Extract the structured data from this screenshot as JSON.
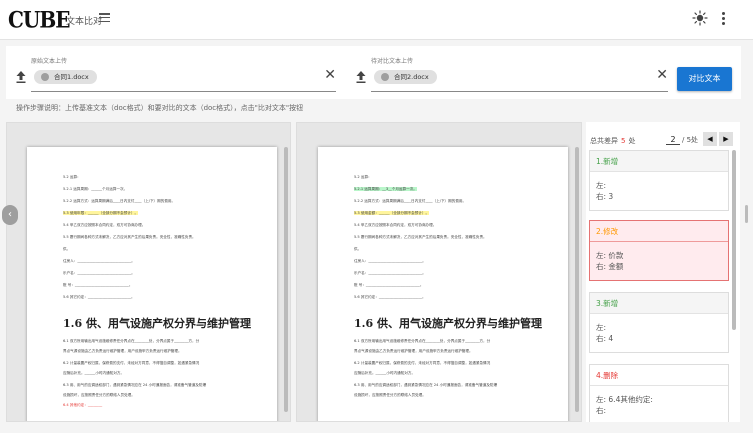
{
  "header": {
    "logo": "CUBE",
    "title": "文本比对",
    "menu_icon": "hamburger-menu-icon",
    "theme_icon": "sun-icon",
    "more_icon": "kebab-menu-icon"
  },
  "upload": {
    "source": {
      "label": "原始文本上传",
      "file": "合同1.docx"
    },
    "target": {
      "label": "待对比文本上传",
      "file": "合同2.docx"
    },
    "compare_button": "对比文本",
    "clear_symbol": "✕"
  },
  "instructions": "操作步骤说明：上传基准文本（doc格式）和要对比的文本（doc格式），点击\"比对文本\"按钮",
  "documents": {
    "left": {
      "lines": [
        "5.2 运算：",
        "5.2.1 运算周期：______个月运算一次。",
        "5.2.2 运算方式：运算周期满后____日内支付____（上/下）期的费用。",
        "5.3 使用年限：______（全部分期不会预计）。",
        "5.4 甲乙双方应按照本合同约定，双方可协商办理。",
        "5.5 履行期间各种方式未解决，乙方应对其产生的后果负责。安全性，准确性负责。",
        "供。",
        "住房人：______________________________。",
        "乐户名：______________________________。",
        "账  号：______________________________。",
        "5.6 其它约定：________________________。"
      ],
      "heading": "1.6  供、用气设施产权分界与维护管理",
      "lines_after": [
        "6.1 双方所用输出用气设施维修责任分界点在________处，分界点属于________方，分",
        "界点气源设施由乙方负责运行维护管理，用户设施甲方负责运行维护管理。",
        "6.2 计量装置产权归属，保修费的支付，未经对方同意，不得擅自调整，如遇紧急情况",
        "应随后补充。______小时内通知对方。",
        "6.3 用、用气的应调适权部门，遇到紧急情况应在 24 小时通报面告，请准备气管道及防爆",
        "设施损坏，应按照责任分方的联络人员处理。",
        "6.4 其他约定：________"
      ]
    },
    "right": {
      "lines": [
        "5.2 运算：",
        "5.2.1 运算周期：__3__个月运算一次。",
        "5.2.2 运算方式：运算周期满后____日内支付____（上/下）期的费用。",
        "5.3 使用金额：______（全部分期不会预计）。",
        "5.4 甲乙双方应按照本合同约定，双方可协商办理。",
        "5.5 履行期间各种方式未解决，乙方应对其产生的后果负责。安全性，准确性负责。",
        "供。",
        "住房人：______________________________。",
        "乐户名：______________________________。",
        "账  号：______________________________。",
        "5.6 其它约定：________________________。"
      ],
      "heading": "1.6  供、用气设施产权分界与维护管理",
      "lines_after": [
        "6.1 双方所用输出用气设施维修责任分界点在________处，分界点属于________方，分",
        "界点气源设施由乙方负责运行维护管理，用户设施甲方负责运行维护管理。",
        "6.2 计量装置产权归属，保修费的支付，未经对方同意，不得擅自调整，如遇紧急情况",
        "应随后补充。______小时内通知对方。",
        "6.3 用、用气的应调适权部门，遇到紧急情况应在 24 小时通报面告，请准备气管道及防爆",
        "设施损坏，应按照责任分方的联络人员处理。"
      ]
    }
  },
  "diff": {
    "summary_prefix": "总共差异",
    "count": "5",
    "unit": "处",
    "current_page": "2",
    "page_total": "/ 5处",
    "prev": "◀",
    "next": "▶",
    "items": [
      {
        "title": "1.新增",
        "left": "左:",
        "right": "右: 3",
        "kind": "add"
      },
      {
        "title": "2.修改",
        "left": "左: 价款",
        "right": "右: 金额",
        "kind": "mod"
      },
      {
        "title": "3.新增",
        "left": "左:",
        "right": "右: 4",
        "kind": "add"
      },
      {
        "title": "4.删除",
        "left": "左: 6.4其他约定:",
        "right": "右:",
        "kind": "del"
      }
    ]
  },
  "colors": {
    "primary": "#1976d2",
    "added": "#43a047",
    "modified": "#ff9800",
    "deleted": "#e53935"
  }
}
